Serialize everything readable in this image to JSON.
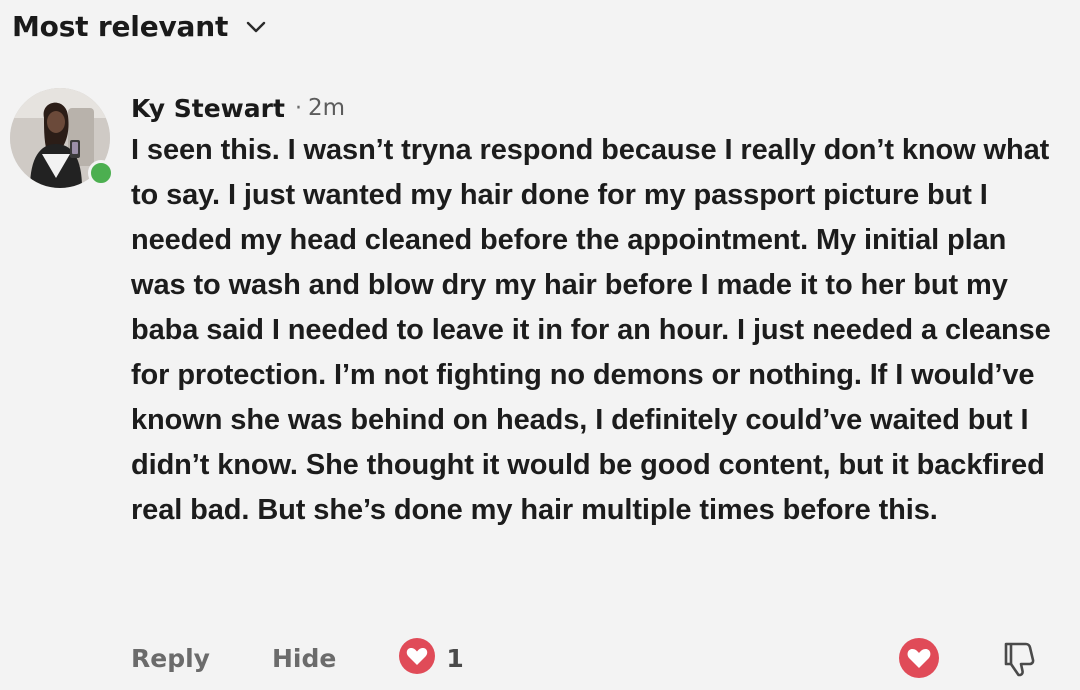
{
  "header": {
    "sort_label": "Most relevant",
    "sort_icon": "chevron-down-icon"
  },
  "comment": {
    "author": "Ky Stewart",
    "separator": "·",
    "timestamp": "2m",
    "online_status_color": "#4caf50",
    "body": "I seen this. I wasn’t tryna respond because I really don’t know what to say. I just wanted my hair done for my passport picture but I needed my head cleaned before the appointment. My initial plan was to wash and blow dry my hair before I made it to her but my baba said I needed to leave it in for an hour. I just needed a cleanse for protection. I’m not fighting no demons or nothing. If I would’ve known she was behind on heads, I definitely could’ve waited but I didn’t know. She thought it would be good content, but it backfired real bad. But she’s done my hair multiple times before this.",
    "actions": {
      "reply_label": "Reply",
      "hide_label": "Hide",
      "reaction_icon": "heart-reaction-icon",
      "reaction_color": "#e04b58",
      "reaction_count": "1"
    },
    "right_actions": {
      "love_icon": "heart-react-icon",
      "dislike_icon": "thumbs-down-icon"
    }
  }
}
